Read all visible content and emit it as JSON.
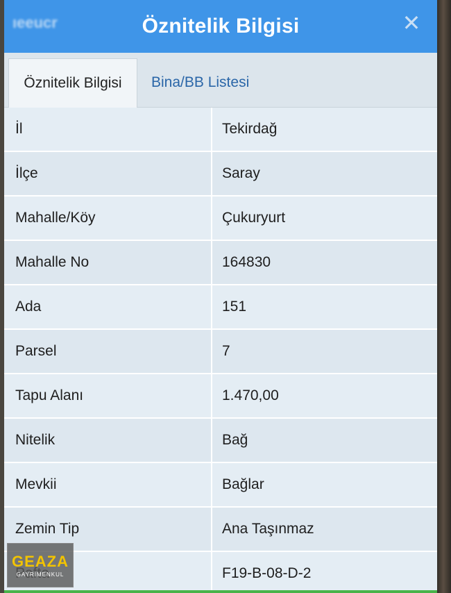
{
  "dialog": {
    "title": "Öznitelik Bilgisi",
    "blurred_header_text": "ıeeucr",
    "close_icon": "close-icon"
  },
  "tabs": [
    {
      "label": "Öznitelik Bilgisi",
      "active": true
    },
    {
      "label": "Bina/BB Listesi",
      "active": false
    }
  ],
  "rows": [
    {
      "key": "İl",
      "value": "Tekirdağ"
    },
    {
      "key": "İlçe",
      "value": "Saray"
    },
    {
      "key": "Mahalle/Köy",
      "value": "Çukuryurt"
    },
    {
      "key": "Mahalle No",
      "value": "164830"
    },
    {
      "key": "Ada",
      "value": "151"
    },
    {
      "key": "Parsel",
      "value": "7"
    },
    {
      "key": "Tapu Alanı",
      "value": "1.470,00"
    },
    {
      "key": "Nitelik",
      "value": "Bağ"
    },
    {
      "key": "Mevkii",
      "value": "Bağlar"
    },
    {
      "key": "Zemin Tip",
      "value": "Ana Taşınmaz"
    },
    {
      "key": "Pafta",
      "value": "F19-B-08-D-2"
    }
  ],
  "logo": {
    "main": "GEAZA",
    "sub": "GAYRİMENKUL"
  },
  "colors": {
    "title_bar": "#3f95e8",
    "tab_link": "#2a66a8",
    "logo_accent": "#f2c300"
  }
}
